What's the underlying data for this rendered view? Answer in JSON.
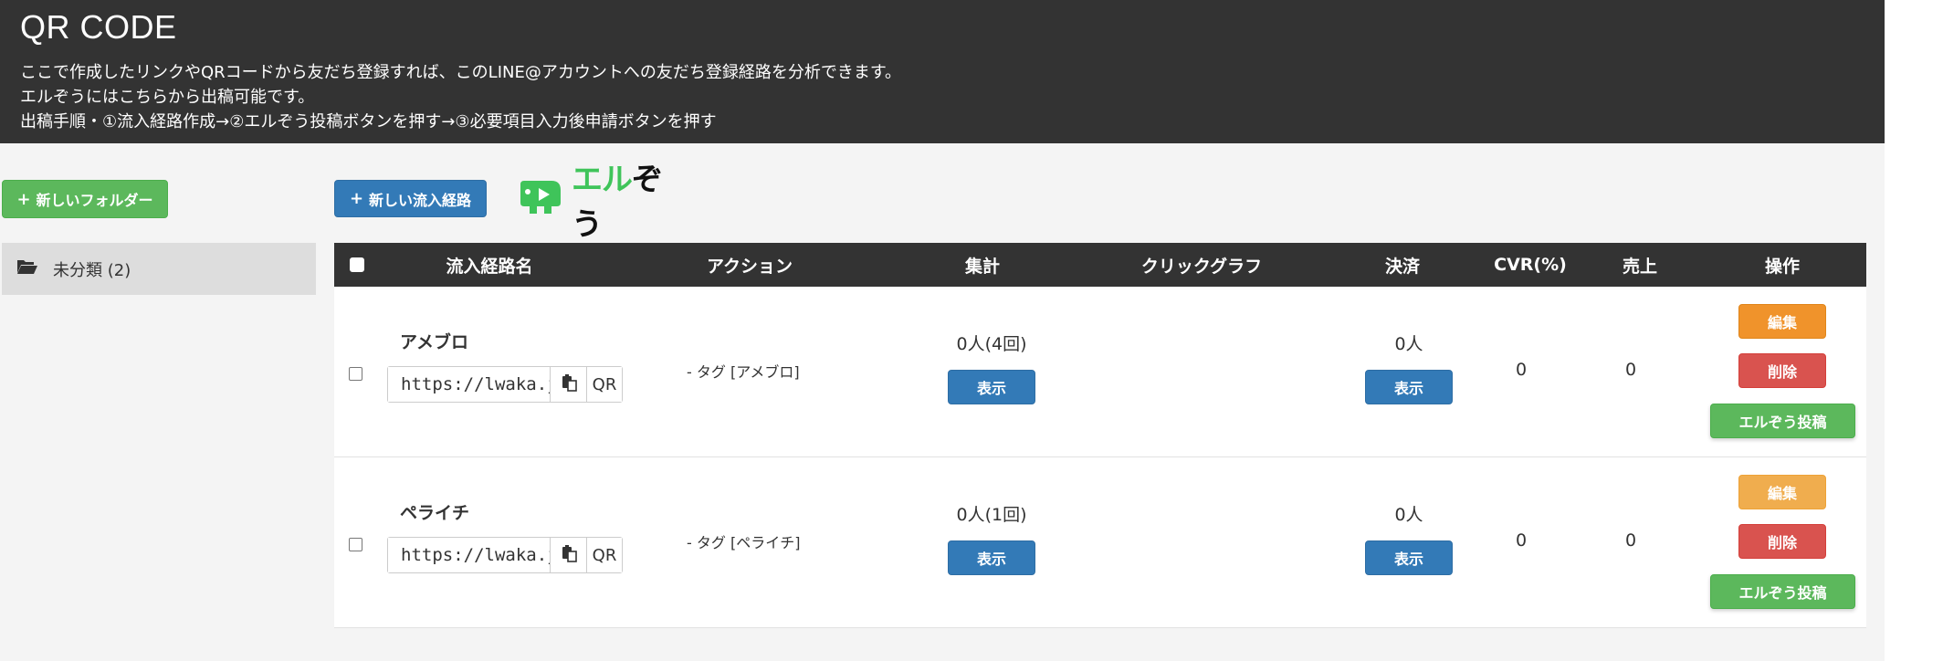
{
  "header": {
    "title": "QR CODE",
    "lines": [
      "ここで作成したリンクやQRコードから友だち登録すれば、このLINE@アカウントへの友だち登録経路を分析できます。",
      "エルぞうにはこちらから出稿可能です。",
      "出稿手順・①流入経路作成→②エルぞう投稿ボタンを押す→③必要項目入力後申請ボタンを押す"
    ]
  },
  "sidebar": {
    "new_folder_label": "新しいフォルダー",
    "folder_icon": "folder-open-icon",
    "folders": [
      {
        "label": "未分類 (2)"
      }
    ]
  },
  "toolbar": {
    "new_route_label": "新しい流入経路",
    "logo_text_green": "エル",
    "logo_text_dark": "ぞう"
  },
  "table": {
    "headers": {
      "name": "流入経路名",
      "action": "アクション",
      "total": "集計",
      "click_graph": "クリックグラフ",
      "payment": "決済",
      "cvr": "CVR(%)",
      "sales": "売上",
      "ops": "操作"
    },
    "rows": [
      {
        "name": "アメブロ",
        "url": "https://lwaka.jp",
        "qr_label": "QR",
        "action": "- タグ [アメブロ]",
        "total": "0人(4回)",
        "show_label": "表示",
        "payment": "0人",
        "payment_show_label": "表示",
        "cvr": "0",
        "sales": "0",
        "edit_label": "編集",
        "delete_label": "削除",
        "post_label": "エルぞう投稿"
      },
      {
        "name": "ペライチ",
        "url": "https://lwaka.jp",
        "qr_label": "QR",
        "action": "- タグ [ペライチ]",
        "total": "0人(1回)",
        "show_label": "表示",
        "payment": "0人",
        "payment_show_label": "表示",
        "cvr": "0",
        "sales": "0",
        "edit_label": "編集",
        "delete_label": "削除",
        "post_label": "エルぞう投稿"
      }
    ]
  },
  "colors": {
    "header_bg": "#333333",
    "green": "#5cb85c",
    "blue": "#337ab7",
    "orange": "#f0932b",
    "red": "#d9534f",
    "logo_green": "#3fc45a"
  }
}
